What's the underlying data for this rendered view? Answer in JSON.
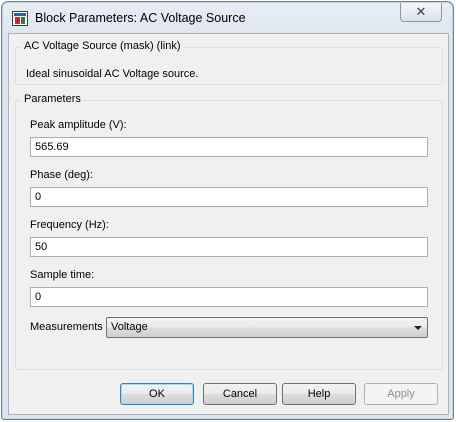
{
  "window": {
    "title": "Block Parameters: AC Voltage Source",
    "close_glyph": "✕",
    "icon": "simulink-block-icon"
  },
  "mask_group": {
    "legend": "AC Voltage Source (mask) (link)",
    "description": "Ideal sinusoidal AC Voltage source."
  },
  "parameters": {
    "legend": "Parameters",
    "fields": [
      {
        "label": "Peak amplitude (V):",
        "value": "565.69"
      },
      {
        "label": "Phase (deg):",
        "value": "0"
      },
      {
        "label": "Frequency (Hz):",
        "value": "50"
      },
      {
        "label": "Sample time:",
        "value": "0"
      }
    ],
    "measurements": {
      "label": "Measurements",
      "selected": "Voltage"
    }
  },
  "buttons": {
    "ok": "OK",
    "cancel": "Cancel",
    "help": "Help",
    "apply": "Apply"
  }
}
